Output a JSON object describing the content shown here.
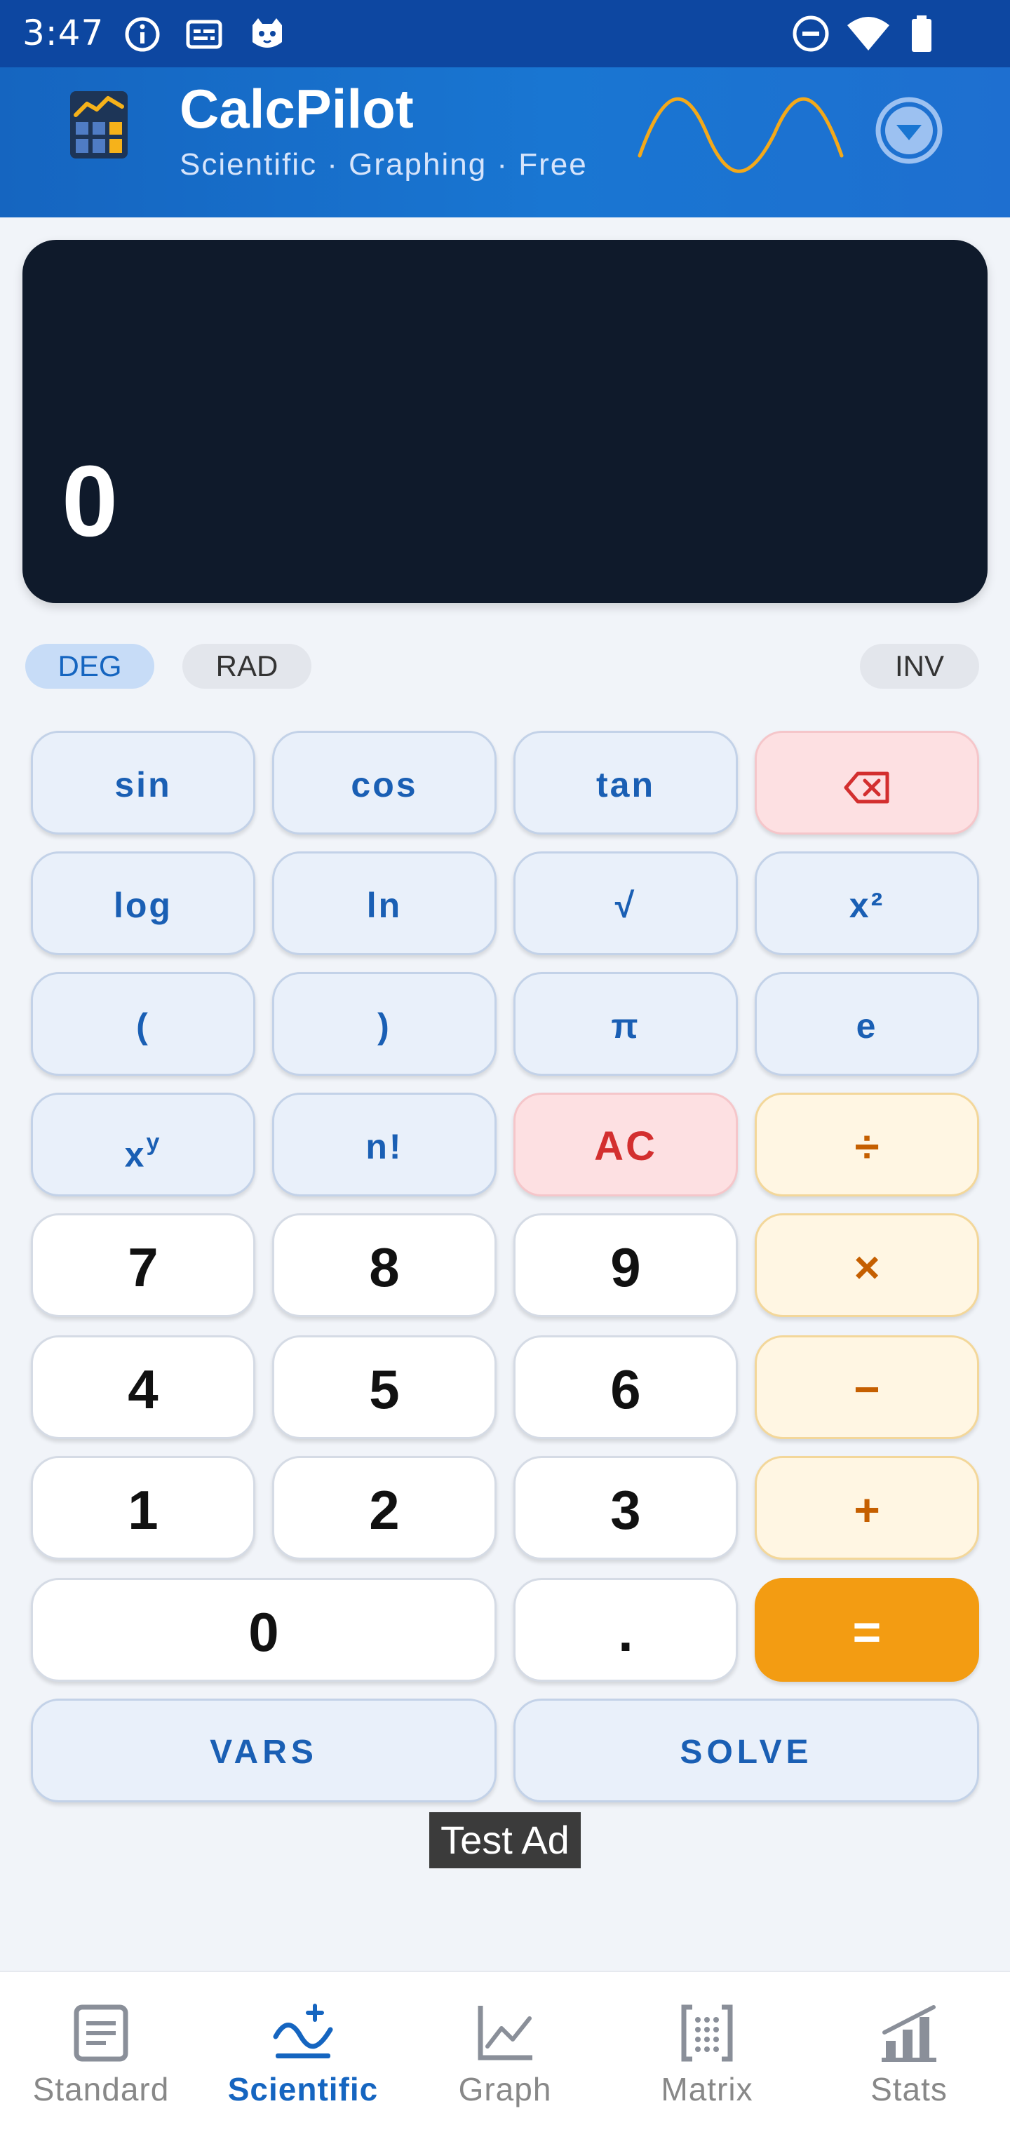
{
  "status_bar": {
    "time": "3:47",
    "left_icons": [
      "info-icon",
      "subtitles-icon",
      "cat-icon"
    ],
    "right_icons": [
      "dnd-icon",
      "wifi-icon",
      "battery-icon"
    ]
  },
  "app_bar": {
    "title": "CalcPilot",
    "subtitle": "Scientific · Graphing · Free",
    "menu_icon": "chevron-down-circle-icon"
  },
  "display": {
    "value": "0"
  },
  "modes": {
    "deg": "DEG",
    "rad": "RAD",
    "inv": "INV",
    "active": "DEG"
  },
  "keypad": {
    "sin": "sin",
    "cos": "cos",
    "tan": "tan",
    "backspace_icon": "backspace-icon",
    "log": "log",
    "ln": "ln",
    "sqrt": "√",
    "square": "x²",
    "lparen": "(",
    "rparen": ")",
    "pi": "π",
    "e": "e",
    "power_base": "x",
    "power_exp": "y",
    "factorial": "n!",
    "clear": "AC",
    "divide": "÷",
    "seven": "7",
    "eight": "8",
    "nine": "9",
    "multiply": "×",
    "four": "4",
    "five": "5",
    "six": "6",
    "minus": "−",
    "one": "1",
    "two": "2",
    "three": "3",
    "plus": "+",
    "zero": "0",
    "dot": ".",
    "equals": "=",
    "vars": "VARS",
    "solve": "SOLVE"
  },
  "ad": {
    "label": "Test Ad"
  },
  "bottom_nav": {
    "items": [
      {
        "label": "Standard",
        "icon": "document-icon"
      },
      {
        "label": "Scientific",
        "icon": "scientific-wave-icon"
      },
      {
        "label": "Graph",
        "icon": "line-chart-icon"
      },
      {
        "label": "Matrix",
        "icon": "matrix-icon"
      },
      {
        "label": "Stats",
        "icon": "bar-chart-icon"
      }
    ],
    "active": "Scientific"
  },
  "colors": {
    "status_bar": "#0d47a1",
    "app_bar": "#1976d2",
    "display_bg": "#0f1a2b",
    "accent_orange": "#f39c12",
    "clear_red": "#d32f2f",
    "function_blue": "#1a5fb4"
  }
}
